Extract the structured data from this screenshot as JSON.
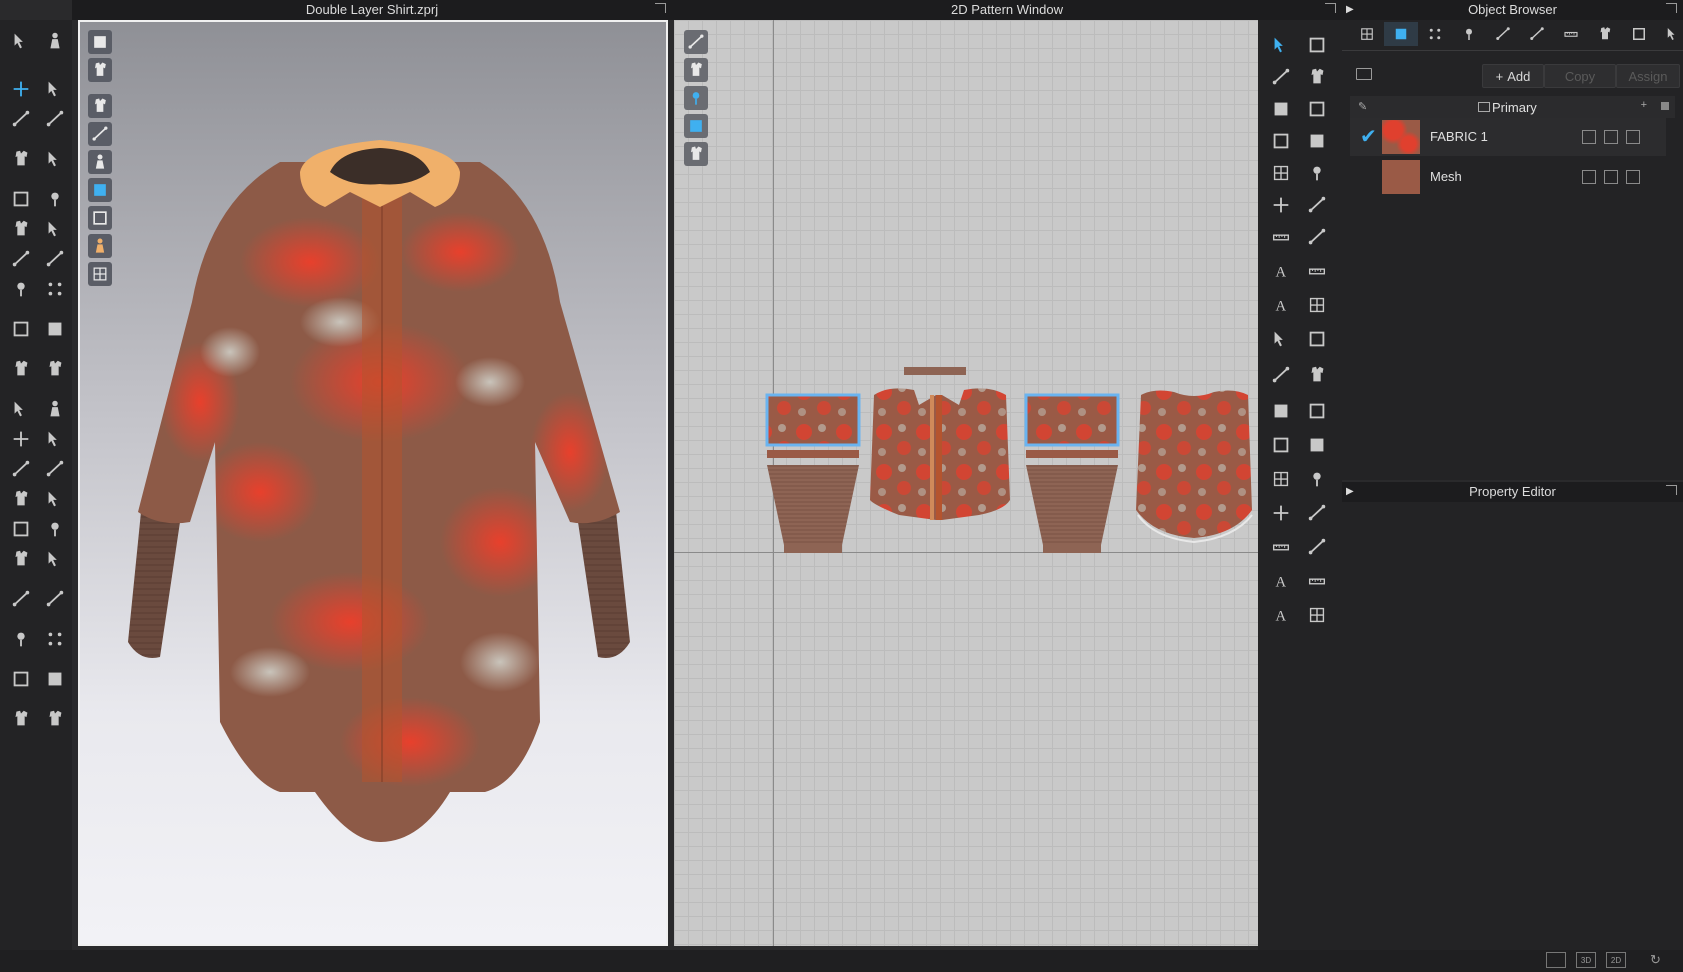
{
  "windows": {
    "view3d_title": "Double Layer Shirt.zprj",
    "pattern2d_title": "2D Pattern Window",
    "object_browser_title": "Object Browser",
    "property_editor_title": "Property Editor"
  },
  "object_browser": {
    "add_label": "Add",
    "copy_label": "Copy",
    "assign_label": "Assign",
    "group_label": "Primary",
    "items": [
      {
        "label": "FABRIC 1",
        "selected": true,
        "swatch": "fabric-camo-red"
      },
      {
        "label": "Mesh",
        "selected": false,
        "swatch": "solid-brown"
      }
    ]
  },
  "status_bar": {
    "view_3d": "3D",
    "view_2d": "2D"
  },
  "colors": {
    "fabric_red": "#d8392a",
    "fabric_brown": "#8d5a47",
    "collar": "#f0b06a",
    "accent_blue": "#4aa8e0",
    "panel_bg": "#2a2a2c"
  }
}
